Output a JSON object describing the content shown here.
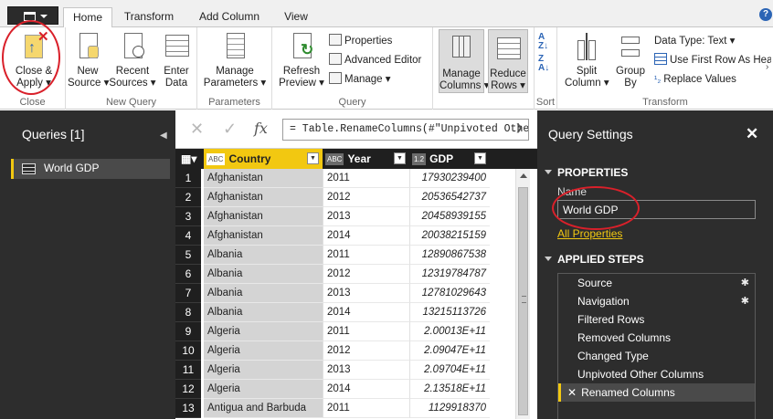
{
  "tabs": [
    {
      "label": "Home",
      "active": true
    },
    {
      "label": "Transform",
      "active": false
    },
    {
      "label": "Add Column",
      "active": false
    },
    {
      "label": "View",
      "active": false
    }
  ],
  "help": "?",
  "ribbon": {
    "close_group": {
      "label": "Close",
      "close_apply": "Close &",
      "close_apply2": "Apply"
    },
    "new_query_group": {
      "label": "New Query",
      "new_source": "New",
      "new_source2": "Source",
      "recent_sources": "Recent",
      "recent_sources2": "Sources",
      "enter_data": "Enter",
      "enter_data2": "Data"
    },
    "parameters_group": {
      "label": "Parameters",
      "manage": "Manage",
      "manage2": "Parameters"
    },
    "query_group": {
      "label": "Query",
      "refresh": "Refresh",
      "refresh2": "Preview",
      "properties": "Properties",
      "advanced_editor": "Advanced Editor",
      "manage": "Manage"
    },
    "manage_columns": {
      "line1": "Manage",
      "line2": "Columns"
    },
    "reduce_rows": {
      "line1": "Reduce",
      "line2": "Rows"
    },
    "sort_group": {
      "label": "Sort"
    },
    "transform_group": {
      "label": "Transform",
      "split": "Split",
      "split2": "Column",
      "group": "Group",
      "group2": "By",
      "data_type": "Data Type: Text",
      "first_row": "Use First Row As Headers",
      "replace": "Replace Values"
    }
  },
  "queries": {
    "title": "Queries [1]",
    "items": [
      "World GDP"
    ]
  },
  "formula": {
    "text": "= Table.RenameColumns(#\"Unpivoted Other Columns\",{{\"Attribute\", \"Year\"}, {\"Value\", \"GDP\"}})"
  },
  "table": {
    "columns": [
      {
        "type": "ABC",
        "name": "Country"
      },
      {
        "type": "ABC",
        "name": "Year"
      },
      {
        "type": "1.2",
        "name": "GDP"
      }
    ],
    "rows": [
      {
        "n": "1",
        "country": "Afghanistan",
        "year": "2011",
        "gdp": "17930239400"
      },
      {
        "n": "2",
        "country": "Afghanistan",
        "year": "2012",
        "gdp": "20536542737"
      },
      {
        "n": "3",
        "country": "Afghanistan",
        "year": "2013",
        "gdp": "20458939155"
      },
      {
        "n": "4",
        "country": "Afghanistan",
        "year": "2014",
        "gdp": "20038215159"
      },
      {
        "n": "5",
        "country": "Albania",
        "year": "2011",
        "gdp": "12890867538"
      },
      {
        "n": "6",
        "country": "Albania",
        "year": "2012",
        "gdp": "12319784787"
      },
      {
        "n": "7",
        "country": "Albania",
        "year": "2013",
        "gdp": "12781029643"
      },
      {
        "n": "8",
        "country": "Albania",
        "year": "2014",
        "gdp": "13215113726"
      },
      {
        "n": "9",
        "country": "Algeria",
        "year": "2011",
        "gdp": "2.00013E+11"
      },
      {
        "n": "10",
        "country": "Algeria",
        "year": "2012",
        "gdp": "2.09047E+11"
      },
      {
        "n": "11",
        "country": "Algeria",
        "year": "2013",
        "gdp": "2.09704E+11"
      },
      {
        "n": "12",
        "country": "Algeria",
        "year": "2014",
        "gdp": "2.13518E+11"
      },
      {
        "n": "13",
        "country": "Antigua and Barbuda",
        "year": "2011",
        "gdp": "1129918370"
      }
    ]
  },
  "settings": {
    "title": "Query Settings",
    "properties_header": "PROPERTIES",
    "name_label": "Name",
    "name_value": "World GDP",
    "all_properties": "All Properties",
    "steps_header": "APPLIED STEPS",
    "steps": [
      {
        "label": "Source",
        "gear": true
      },
      {
        "label": "Navigation",
        "gear": true
      },
      {
        "label": "Filtered Rows",
        "gear": false
      },
      {
        "label": "Removed Columns",
        "gear": false
      },
      {
        "label": "Changed Type",
        "gear": false
      },
      {
        "label": "Unpivoted Other Columns",
        "gear": false
      },
      {
        "label": "Renamed Columns",
        "gear": false,
        "selected": true
      }
    ]
  },
  "colors": {
    "accent": "#f2c811",
    "pane": "#2d2d2d",
    "annotation": "#d9202a"
  }
}
